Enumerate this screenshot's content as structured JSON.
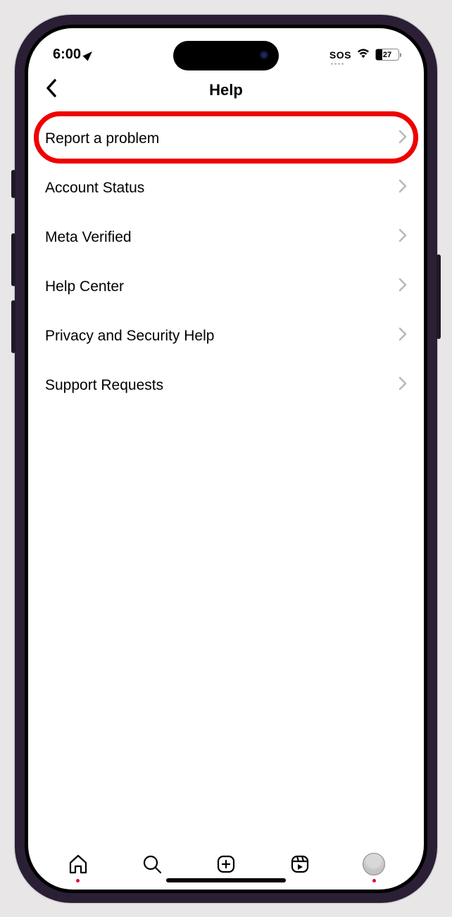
{
  "status": {
    "time": "6:00",
    "sos": "SOS",
    "battery": "27"
  },
  "header": {
    "title": "Help"
  },
  "menu": {
    "items": [
      {
        "label": "Report a problem",
        "highlighted": true
      },
      {
        "label": "Account Status",
        "highlighted": false
      },
      {
        "label": "Meta Verified",
        "highlighted": false
      },
      {
        "label": "Help Center",
        "highlighted": false
      },
      {
        "label": "Privacy and Security Help",
        "highlighted": false
      },
      {
        "label": "Support Requests",
        "highlighted": false
      }
    ]
  }
}
